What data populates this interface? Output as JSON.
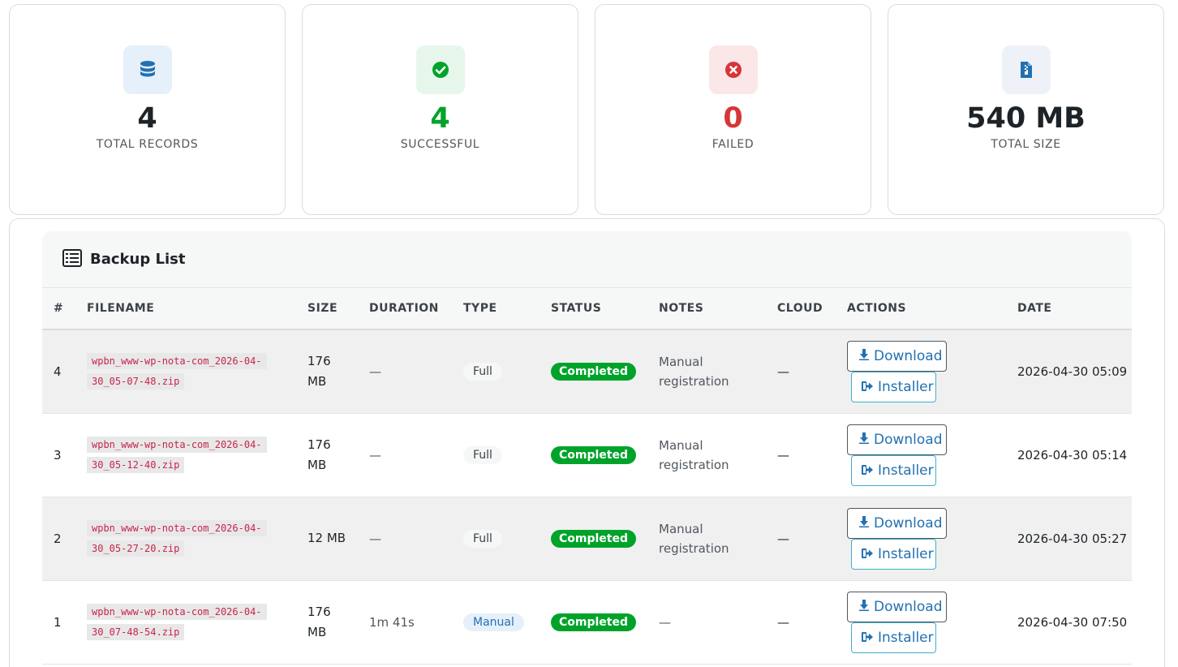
{
  "stats": [
    {
      "value": "4",
      "label": "TOTAL RECORDS",
      "icon": "database-icon",
      "color": "#1d2327",
      "tile": "#e5f0fa"
    },
    {
      "value": "4",
      "label": "SUCCESSFUL",
      "icon": "check-circle-icon",
      "color": "#00a32a",
      "tile": "#e7f6ea"
    },
    {
      "value": "0",
      "label": "FAILED",
      "icon": "x-circle-icon",
      "color": "#d63638",
      "tile": "#fbe7e7"
    },
    {
      "value": "540 MB",
      "label": "TOTAL SIZE",
      "icon": "zip-file-icon",
      "color": "#1d2327",
      "tile": "#eef2f8"
    }
  ],
  "backup_list": {
    "title": "Backup List",
    "columns": [
      "#",
      "FILENAME",
      "SIZE",
      "DURATION",
      "TYPE",
      "STATUS",
      "NOTES",
      "CLOUD",
      "ACTIONS",
      "DATE"
    ],
    "rows": [
      {
        "num": "4",
        "filename_a": "wpbn_www-wp-nota-com_2026-04-",
        "filename_b": "30_05-07-48.zip",
        "size_a": "176",
        "size_b": "MB",
        "duration": "—",
        "type": "Full",
        "status": "Completed",
        "notes_a": "Manual",
        "notes_b": "registration",
        "cloud": "—",
        "download": "Download",
        "installer": "Installer",
        "date": "2026-04-30 05:09"
      },
      {
        "num": "3",
        "filename_a": "wpbn_www-wp-nota-com_2026-04-",
        "filename_b": "30_05-12-40.zip",
        "size_a": "176",
        "size_b": "MB",
        "duration": "—",
        "type": "Full",
        "status": "Completed",
        "notes_a": "Manual",
        "notes_b": "registration",
        "cloud": "—",
        "download": "Download",
        "installer": "Installer",
        "date": "2026-04-30 05:14"
      },
      {
        "num": "2",
        "filename_a": "wpbn_www-wp-nota-com_2026-04-",
        "filename_b": "30_05-27-20.zip",
        "size_a": "12 MB",
        "size_b": "",
        "duration": "—",
        "type": "Full",
        "status": "Completed",
        "notes_a": "Manual",
        "notes_b": "registration",
        "cloud": "—",
        "download": "Download",
        "installer": "Installer",
        "date": "2026-04-30 05:27"
      },
      {
        "num": "1",
        "filename_a": "wpbn_www-wp-nota-com_2026-04-",
        "filename_b": "30_07-48-54.zip",
        "size_a": "176",
        "size_b": "MB",
        "duration": "1m 41s",
        "type": "Manual",
        "status": "Completed",
        "notes_a": "—",
        "notes_b": "",
        "cloud": "—",
        "download": "Download",
        "installer": "Installer",
        "date": "2026-04-30 07:50"
      }
    ]
  }
}
